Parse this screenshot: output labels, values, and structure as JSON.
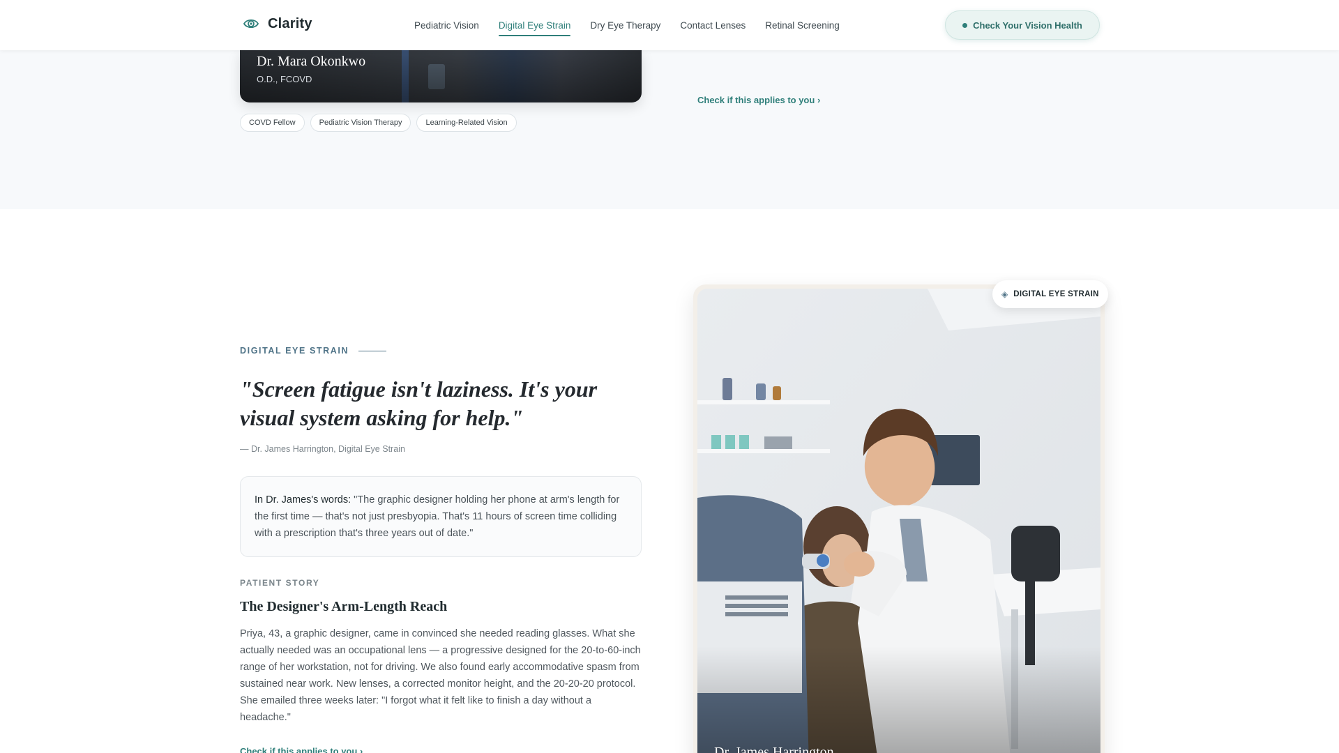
{
  "header": {
    "brand": "Clarity",
    "nav": [
      {
        "label": "Pediatric Vision"
      },
      {
        "label": "Digital Eye Strain"
      },
      {
        "label": "Dry Eye Therapy"
      },
      {
        "label": "Contact Lenses"
      },
      {
        "label": "Retinal Screening"
      }
    ],
    "active_nav": "Digital Eye Strain",
    "cta_label": "Check Your Vision Health"
  },
  "previous_section": {
    "doctor_name": "Dr. Mara Okonkwo",
    "credentials": "O.D., FCOVD",
    "tags": [
      "COVD Fellow",
      "Pediatric Vision Therapy",
      "Learning-Related Vision"
    ],
    "link_text": "Check if this applies to you"
  },
  "section": {
    "eyebrow": "DIGITAL EYE STRAIN",
    "quote": "\"Screen fatigue isn't laziness. It's your visual system asking for help.\"",
    "attribution": "— Dr. James Harrington, Digital Eye Strain",
    "words_lead": "In Dr. James's words:",
    "words_text": "\"The graphic designer holding her phone at arm's length for the first time — that's not just presbyopia. That's 11 hours of screen time colliding with a prescription that's three years out of date.\"",
    "story_eyebrow": "PATIENT STORY",
    "story_title": "The Designer's Arm-Length Reach",
    "story_body": "Priya, 43, a graphic designer, came in convinced she needed reading glasses. What she actually needed was an occupational lens — a progressive designed for the 20-to-60-inch range of her workstation, not for driving. We also found early accommodative spasm from sustained near work. New lenses, a corrected monitor height, and the 20-20-20 protocol. She emailed three weeks later: \"I forgot what it felt like to finish a day without a headache.\"",
    "link_text": "Check if this applies to you",
    "photo_badge": "DIGITAL EYE STRAIN",
    "photo_caption": "Dr. James Harrington"
  },
  "colors": {
    "accent": "#2f7f7a",
    "eyebrow": "#4f7387",
    "section_bg": "#f7f9fb"
  },
  "icons": {
    "brand": "eye-logo-icon",
    "cta": "status-dot-icon",
    "link": "chevron-right-icon",
    "badge": "diamond-icon"
  }
}
